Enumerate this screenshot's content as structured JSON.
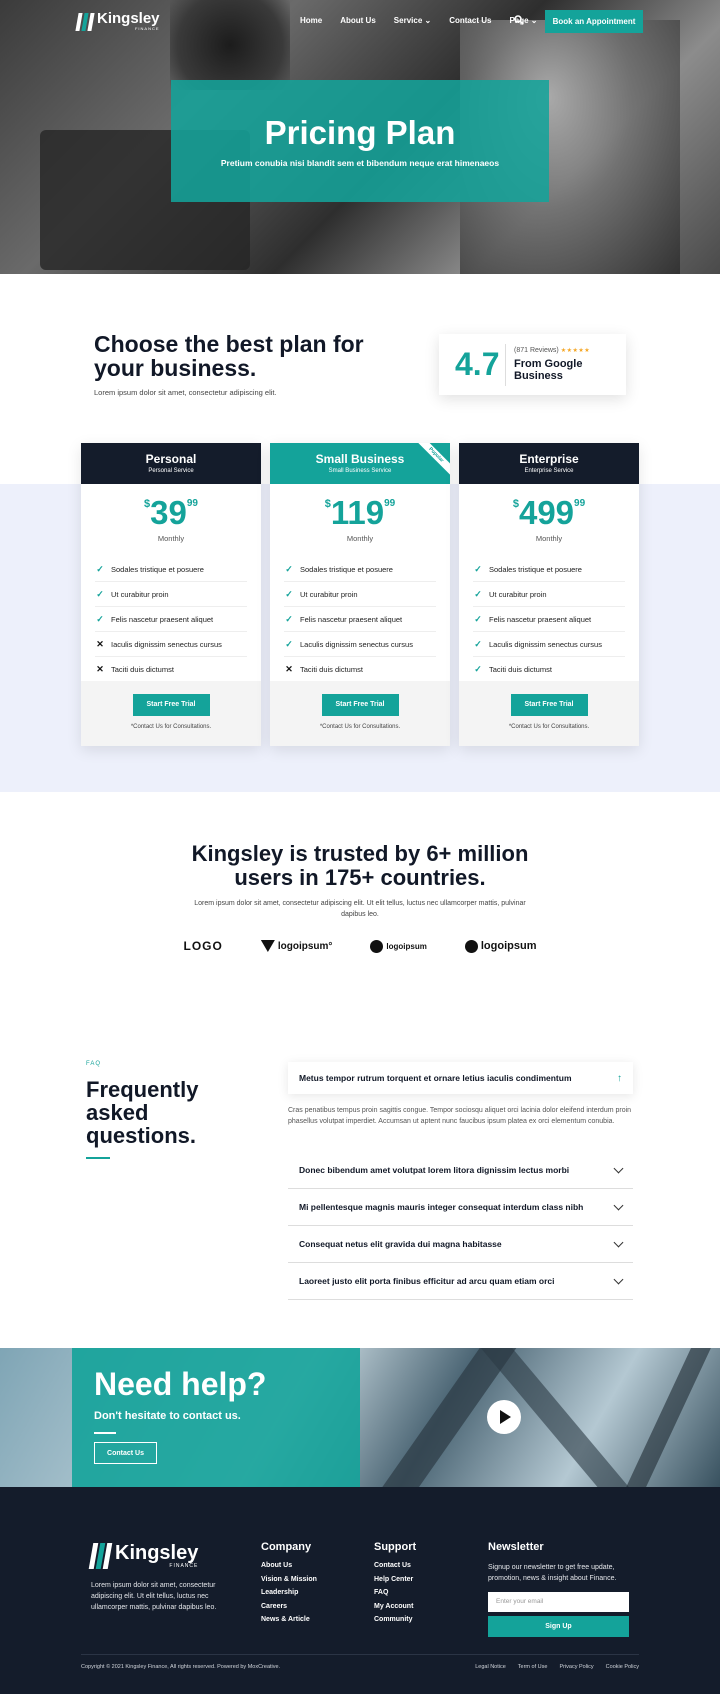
{
  "brand": {
    "name": "Kingsley",
    "tag": "FINANCE"
  },
  "nav": {
    "items": [
      "Home",
      "About Us",
      "Service",
      "Contact Us",
      "Page"
    ],
    "cta": "Book an Appointment"
  },
  "hero": {
    "title": "Pricing Plan",
    "subtitle": "Pretium conubia nisi blandit sem et bibendum neque erat himenaeos"
  },
  "intro": {
    "title": "Choose the best plan for your business.",
    "desc": "Lorem ipsum dolor sit amet, consectetur adipiscing elit.",
    "rating": {
      "value": "4.7",
      "reviews": "(871 Reviews)",
      "stars": "★★★★★",
      "source": "From Google Business"
    }
  },
  "plans": [
    {
      "name": "Personal",
      "service": "Personal Service",
      "currency": "$",
      "amount": "39",
      "cents": "99",
      "period": "Monthly",
      "popular": false,
      "features": [
        {
          "text": "Sodales tristique et posuere",
          "included": true
        },
        {
          "text": "Ut curabitur proin",
          "included": true
        },
        {
          "text": "Felis nascetur praesent aliquet",
          "included": true
        },
        {
          "text": "Iaculis dignissim senectus cursus",
          "included": false
        },
        {
          "text": "Taciti duis dictumst",
          "included": false
        }
      ],
      "cta": "Start Free Trial",
      "note": "*Contact Us for Consultations."
    },
    {
      "name": "Small Business",
      "service": "Small Business Service",
      "currency": "$",
      "amount": "119",
      "cents": "99",
      "period": "Monthly",
      "popular": true,
      "badge": "Popular",
      "features": [
        {
          "text": "Sodales tristique et posuere",
          "included": true
        },
        {
          "text": "Ut curabitur proin",
          "included": true
        },
        {
          "text": "Felis nascetur praesent aliquet",
          "included": true
        },
        {
          "text": "Laculis dignissim senectus cursus",
          "included": true
        },
        {
          "text": "Taciti duis dictumst",
          "included": false
        }
      ],
      "cta": "Start Free Trial",
      "note": "*Contact Us for Consultations."
    },
    {
      "name": "Enterprise",
      "service": "Enterprise Service",
      "currency": "$",
      "amount": "499",
      "cents": "99",
      "period": "Monthly",
      "popular": false,
      "features": [
        {
          "text": "Sodales tristique et posuere",
          "included": true
        },
        {
          "text": "Ut curabitur proin",
          "included": true
        },
        {
          "text": "Felis nascetur praesent aliquet",
          "included": true
        },
        {
          "text": "Laculis dignissim senectus cursus",
          "included": true
        },
        {
          "text": "Taciti duis dictumst",
          "included": true
        }
      ],
      "cta": "Start Free Trial",
      "note": "*Contact Us for Consultations."
    }
  ],
  "trust": {
    "title": "Kingsley is trusted by 6+ million users in 175+ countries.",
    "desc": "Lorem ipsum dolor sit amet, consectetur adipiscing elit. Ut elit tellus, luctus nec ullamcorper mattis, pulvinar dapibus leo.",
    "logos": [
      "LOGO",
      "logoipsum°",
      "logoipsum",
      "logoipsum"
    ]
  },
  "faq": {
    "kicker": "FAQ",
    "title": "Frequently asked questions.",
    "open": {
      "question": "Metus tempor rutrum torquent et ornare letius iaculis condimentum",
      "answer": "Cras penatibus tempus proin sagittis congue. Tempor sociosqu aliquet orci lacinia dolor eleifend interdum proin phasellus volutpat imperdiet. Accumsan ut aptent nunc faucibus ipsum platea ex orci elementum conubia."
    },
    "items": [
      "Donec bibendum amet volutpat lorem litora dignissim lectus morbi",
      "Mi pellentesque magnis mauris integer consequat interdum class nibh",
      "Consequat netus elit gravida dui magna habitasse",
      "Laoreet justo elit porta finibus efficitur ad arcu quam etiam orci"
    ]
  },
  "help": {
    "title": "Need help?",
    "subtitle": "Don't hesitate to contact us.",
    "cta": "Contact Us"
  },
  "footer": {
    "desc": "Lorem ipsum dolor sit amet, consectetur adipiscing elit. Ut elit tellus, luctus nec ullamcorper mattis, pulvinar dapibus leo.",
    "company": {
      "title": "Company",
      "links": [
        "About Us",
        "Vision & Mission",
        "Leadership",
        "Careers",
        "News & Article"
      ]
    },
    "support": {
      "title": "Support",
      "links": [
        "Contact Us",
        "Help Center",
        "FAQ",
        "My Account",
        "Community"
      ]
    },
    "newsletter": {
      "title": "Newsletter",
      "desc": "Signup our newsletter to get free update, promotion, news & insight about Finance.",
      "placeholder": "Enter your email",
      "cta": "Sign Up"
    },
    "copyright": "Copyright © 2021 Kingsley Finance, All rights reserved. Powered by MoxCreative.",
    "legal": [
      "Legal Notice",
      "Term of Use",
      "Privacy Policy",
      "Cookie Policy"
    ]
  },
  "colors": {
    "accent": "#14a39a",
    "dark": "#141c2b",
    "lavender": "#edf0fb"
  }
}
